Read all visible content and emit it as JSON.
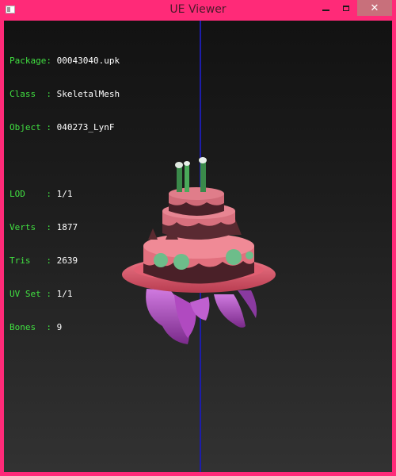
{
  "window": {
    "title": "UE Viewer",
    "controls": {
      "minimize": "minimize-icon",
      "maximize": "maximize-icon",
      "close": "✕"
    }
  },
  "info": {
    "group1": [
      {
        "label": "Package: ",
        "value": "00043040.upk"
      },
      {
        "label": "Class  : ",
        "value": "SkeletalMesh"
      },
      {
        "label": "Object : ",
        "value": "040273_LynF"
      }
    ],
    "group2": [
      {
        "label": "LOD    : ",
        "value": "1/1"
      },
      {
        "label": "Verts  : ",
        "value": "1877"
      },
      {
        "label": "Tris   : ",
        "value": "2639"
      },
      {
        "label": "UV Set : ",
        "value": "1/1"
      },
      {
        "label": "Bones  : ",
        "value": "9"
      }
    ]
  },
  "colors": {
    "frame": "#ff2a78",
    "label": "#41e041",
    "value": "#ffffff",
    "axis": "#1d1daa"
  }
}
